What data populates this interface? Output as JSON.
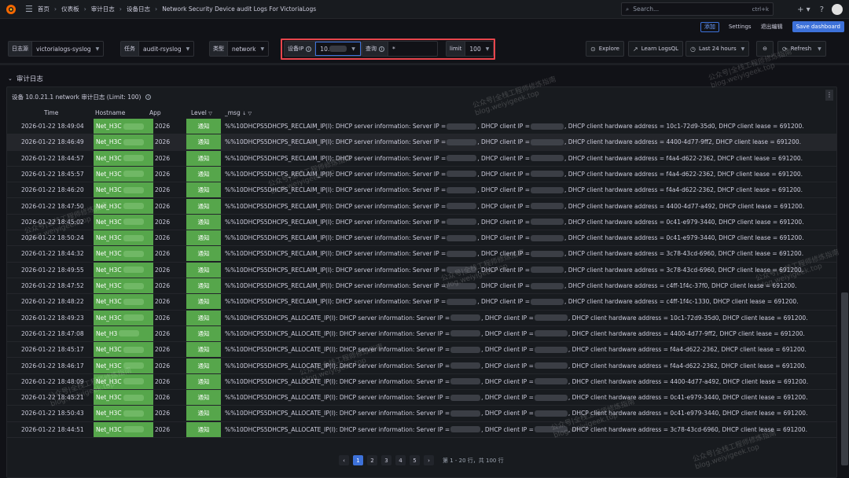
{
  "nav": {
    "breadcrumbs": [
      "首页",
      "仪表板",
      "审计日志",
      "设备日志",
      "Network Security Device audit Logs For VictoriaLogs"
    ],
    "search_placeholder": "Search...",
    "search_shortcut": "ctrl+k"
  },
  "toolbar": {
    "add_label": "添加",
    "settings_label": "Settings",
    "exit_edit_label": "退出编辑",
    "save_label": "Save dashboard"
  },
  "variables": {
    "datasource": {
      "label": "日志源",
      "value": "victorialogs-syslog"
    },
    "task": {
      "label": "任务",
      "value": "audit-rsyslog"
    },
    "type": {
      "label": "类型",
      "value": "network"
    },
    "device_ip": {
      "label": "设备IP",
      "value": "10."
    },
    "query": {
      "label": "查询",
      "value": "*"
    },
    "limit": {
      "label": "limit",
      "value": "100"
    }
  },
  "actions": {
    "explore": "Explore",
    "learn": "Learn LogsQL",
    "time_range": "Last 24 hours",
    "refresh": "Refresh"
  },
  "row": {
    "title": "审计日志"
  },
  "panel": {
    "title": "设备 10.0.21.1 network 审计日志 (Limit: 100)",
    "columns": {
      "time": "Time",
      "hostname": "Hostname",
      "app": "App",
      "level": "Level",
      "msg": "_msg"
    },
    "rows": [
      {
        "time": "2026-01-22 18:49:04",
        "host": "Net_H3C",
        "app": "2026",
        "level": "通知",
        "msg_a": "%%10DHCPS5DHCPS_RECLAIM_IP(I): DHCP server information: Server IP =",
        "msg_b": ", DHCP client IP =",
        "msg_c": ", DHCP client hardware address = 10c1-72d9-35d0, DHCP client lease = 691200."
      },
      {
        "time": "2026-01-22 18:46:49",
        "host": "Net_H3C",
        "app": "2026",
        "level": "通知",
        "msg_a": "%%10DHCPS5DHCPS_RECLAIM_IP(I): DHCP server information: Server IP =",
        "msg_b": ", DHCP client IP =",
        "msg_c": ", DHCP client hardware address = 4400-4d77-9ff2, DHCP client lease = 691200."
      },
      {
        "time": "2026-01-22 18:44:57",
        "host": "Net_H3C",
        "app": "2026",
        "level": "通知",
        "msg_a": "%%10DHCPS5DHCPS_RECLAIM_IP(I): DHCP server information: Server IP =",
        "msg_b": ", DHCP client IP =",
        "msg_c": ", DHCP client hardware address = f4a4-d622-2362, DHCP client lease = 691200."
      },
      {
        "time": "2026-01-22 18:45:57",
        "host": "Net_H3C",
        "app": "2026",
        "level": "通知",
        "msg_a": "%%10DHCPS5DHCPS_RECLAIM_IP(I): DHCP server information: Server IP =",
        "msg_b": ", DHCP client IP =",
        "msg_c": ", DHCP client hardware address = f4a4-d622-2362, DHCP client lease = 691200."
      },
      {
        "time": "2026-01-22 18:46:20",
        "host": "Net_H3C",
        "app": "2026",
        "level": "通知",
        "msg_a": "%%10DHCPS5DHCPS_RECLAIM_IP(I): DHCP server information: Server IP =",
        "msg_b": ", DHCP client IP =",
        "msg_c": ", DHCP client hardware address = f4a4-d622-2362, DHCP client lease = 691200."
      },
      {
        "time": "2026-01-22 18:47:50",
        "host": "Net_H3C",
        "app": "2026",
        "level": "通知",
        "msg_a": "%%10DHCPS5DHCPS_RECLAIM_IP(I): DHCP server information: Server IP =",
        "msg_b": ", DHCP client IP =",
        "msg_c": ", DHCP client hardware address = 4400-4d77-a492, DHCP client lease = 691200."
      },
      {
        "time": "2026-01-22 18:45:02",
        "host": "Net_H3C",
        "app": "2026",
        "level": "通知",
        "msg_a": "%%10DHCPS5DHCPS_RECLAIM_IP(I): DHCP server information: Server IP =",
        "msg_b": ", DHCP client IP =",
        "msg_c": ", DHCP client hardware address = 0c41-e979-3440, DHCP client lease = 691200."
      },
      {
        "time": "2026-01-22 18:50:24",
        "host": "Net_H3C",
        "app": "2026",
        "level": "通知",
        "msg_a": "%%10DHCPS5DHCPS_RECLAIM_IP(I): DHCP server information: Server IP =",
        "msg_b": ", DHCP client IP =",
        "msg_c": ", DHCP client hardware address = 0c41-e979-3440, DHCP client lease = 691200."
      },
      {
        "time": "2026-01-22 18:44:32",
        "host": "Net_H3C",
        "app": "2026",
        "level": "通知",
        "msg_a": "%%10DHCPS5DHCPS_RECLAIM_IP(I): DHCP server information: Server IP =",
        "msg_b": ", DHCP client IP =",
        "msg_c": ", DHCP client hardware address = 3c78-43cd-6960, DHCP client lease = 691200."
      },
      {
        "time": "2026-01-22 18:49:55",
        "host": "Net_H3C",
        "app": "2026",
        "level": "通知",
        "msg_a": "%%10DHCPS5DHCPS_RECLAIM_IP(I): DHCP server information: Server IP =",
        "msg_b": ", DHCP client IP =",
        "msg_c": ", DHCP client hardware address = 3c78-43cd-6960, DHCP client lease = 691200."
      },
      {
        "time": "2026-01-22 18:47:52",
        "host": "Net_H3C",
        "app": "2026",
        "level": "通知",
        "msg_a": "%%10DHCPS5DHCPS_RECLAIM_IP(I): DHCP server information: Server IP =",
        "msg_b": ", DHCP client IP =",
        "msg_c": ", DHCP client hardware address = c4ff-1f4c-37f0, DHCP client lease = 691200."
      },
      {
        "time": "2026-01-22 18:48:22",
        "host": "Net_H3C",
        "app": "2026",
        "level": "通知",
        "msg_a": "%%10DHCPS5DHCPS_RECLAIM_IP(I): DHCP server information: Server IP =",
        "msg_b": ", DHCP client IP =",
        "msg_c": ", DHCP client hardware address = c4ff-1f4c-1330, DHCP client lease = 691200."
      },
      {
        "time": "2026-01-22 18:49:23",
        "host": "Net_H3C",
        "app": "2026",
        "level": "通知",
        "msg_a": "%%10DHCPS5DHCPS_ALLOCATE_IP(I): DHCP server information: Server IP =",
        "msg_b": ", DHCP client IP =",
        "msg_c": ", DHCP client hardware address = 10c1-72d9-35d0, DHCP client lease = 691200."
      },
      {
        "time": "2026-01-22 18:47:08",
        "host": "Net_H3",
        "app": "2026",
        "level": "通知",
        "msg_a": "%%10DHCPS5DHCPS_ALLOCATE_IP(I): DHCP server information: Server IP =",
        "msg_b": ", DHCP client IP =",
        "msg_c": ", DHCP client hardware address = 4400-4d77-9ff2, DHCP client lease = 691200."
      },
      {
        "time": "2026-01-22 18:45:17",
        "host": "Net_H3C",
        "app": "2026",
        "level": "通知",
        "msg_a": "%%10DHCPS5DHCPS_ALLOCATE_IP(I): DHCP server information: Server IP =",
        "msg_b": ", DHCP client IP =",
        "msg_c": ", DHCP client hardware address = f4a4-d622-2362, DHCP client lease = 691200."
      },
      {
        "time": "2026-01-22 18:46:17",
        "host": "Net_H3C",
        "app": "2026",
        "level": "通知",
        "msg_a": "%%10DHCPS5DHCPS_ALLOCATE_IP(I): DHCP server information: Server IP =",
        "msg_b": ", DHCP client IP =",
        "msg_c": ", DHCP client hardware address = f4a4-d622-2362, DHCP client lease = 691200."
      },
      {
        "time": "2026-01-22 18:48:09",
        "host": "Net_H3C",
        "app": "2026",
        "level": "通知",
        "msg_a": "%%10DHCPS5DHCPS_ALLOCATE_IP(I): DHCP server information: Server IP =",
        "msg_b": ", DHCP client IP =",
        "msg_c": ", DHCP client hardware address = 4400-4d77-a492, DHCP client lease = 691200."
      },
      {
        "time": "2026-01-22 18:45:21",
        "host": "Net_H3C",
        "app": "2026",
        "level": "通知",
        "msg_a": "%%10DHCPS5DHCPS_ALLOCATE_IP(I): DHCP server information: Server IP =",
        "msg_b": ", DHCP client IP =",
        "msg_c": ", DHCP client hardware address = 0c41-e979-3440, DHCP client lease = 691200."
      },
      {
        "time": "2026-01-22 18:50:43",
        "host": "Net_H3C",
        "app": "2026",
        "level": "通知",
        "msg_a": "%%10DHCPS5DHCPS_ALLOCATE_IP(I): DHCP server information: Server IP =",
        "msg_b": ", DHCP client IP =",
        "msg_c": ", DHCP client hardware address = 0c41-e979-3440, DHCP client lease = 691200."
      },
      {
        "time": "2026-01-22 18:44:51",
        "host": "Net_H3C",
        "app": "2026",
        "level": "通知",
        "msg_a": "%%10DHCPS5DHCPS_ALLOCATE_IP(I): DHCP server information: Server IP =",
        "msg_b": ", DHCP client IP =",
        "msg_c": ", DHCP client hardware address = 3c78-43cd-6960, DHCP client lease = 691200."
      }
    ],
    "pagination": {
      "pages": [
        "1",
        "2",
        "3",
        "4",
        "5"
      ],
      "info": "第 1 - 20 行，共 100 行"
    }
  },
  "watermark": {
    "line1": "公众号|全栈工程师修炼指南",
    "line2": "blog.weiyigeek.top"
  },
  "colors": {
    "accent": "#3d71d9",
    "level_notice": "#56a64b",
    "highlight_border": "#e8454c"
  }
}
